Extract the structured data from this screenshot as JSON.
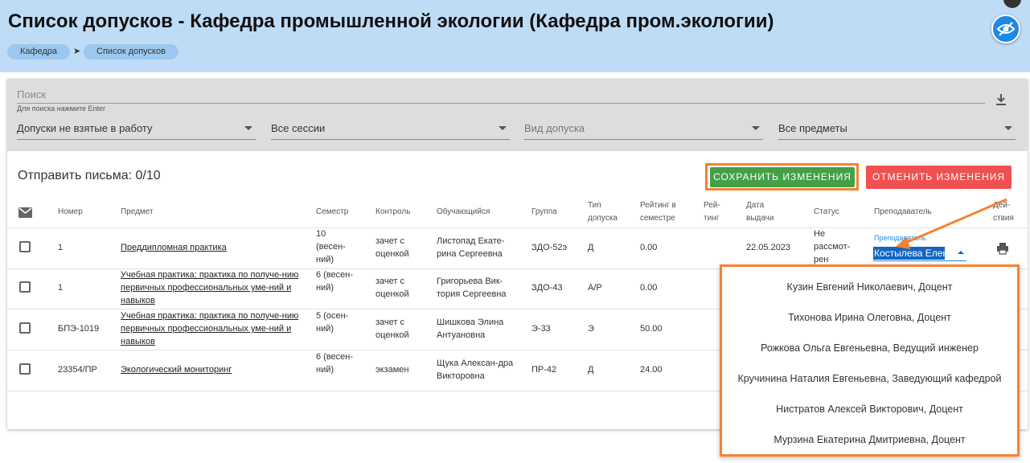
{
  "header": {
    "title": "Список допусков - Кафедра промышленной экологии (Кафедра пром.экологии)",
    "breadcrumbs": [
      "Кафедра",
      "Список допусков"
    ]
  },
  "filters": {
    "search_placeholder": "Поиск",
    "search_hint": "Для поиска нажмите Enter",
    "selects": [
      "Допуски не взятые в работу",
      "Все сессии",
      "Вид допуска",
      "Все предметы"
    ]
  },
  "toolbar": {
    "mail_count": "Отправить письма: 0/10",
    "save_label": "СОХРАНИТЬ ИЗМЕНЕНИЯ",
    "cancel_label": "ОТМЕНИТЬ ИЗМЕНЕНИЯ"
  },
  "table": {
    "headers": {
      "number": "Номер",
      "subject": "Предмет",
      "semester": "Семестр",
      "control": "Контроль",
      "student": "Обучающийся",
      "group": "Группа",
      "type": "Тип допуска",
      "rating_sem": "Рейтинг в семестре",
      "rating": "Рей-тинг",
      "date": "Дата выдачи",
      "status": "Статус",
      "teacher": "Преподаватель",
      "actions": "Дей-ствия"
    },
    "rows": [
      {
        "number": "1",
        "subject": "Преддипломная практика",
        "semester": "10 (весен-ний)",
        "control": "зачет с оценкой",
        "student": "Листопад Екате-рина Сергеевна",
        "group": "ЗДО-52э",
        "type": "Д",
        "rating_sem": "0.00",
        "date": "22.05.2023",
        "status": "Не рассмот-рен"
      },
      {
        "number": "1",
        "subject": "Учебная практика: практика по получе-нию первичных профессиональных уме-ний и навыков",
        "semester": "6 (весен-ний)",
        "control": "зачет с оценкой",
        "student": "Григорьева Вик-тория Сергеевна",
        "group": "ЗДО-43",
        "type": "А/Р",
        "rating_sem": "0.00"
      },
      {
        "number": "БПЭ-1019",
        "subject": "Учебная практика: практика по получе-нию первичных профессиональных уме-ний и навыков",
        "semester": "5 (осен-ний)",
        "control": "зачет с оценкой",
        "student": "Шишкова Элина Антуановна",
        "group": "Э-33",
        "type": "Э",
        "rating_sem": "50.00"
      },
      {
        "number": "23354/ПР",
        "subject": "Экологический мониторинг",
        "semester": "6 (весен-ний)",
        "control": "экзамен",
        "student": "Щука Алексан-дра Викторовна",
        "group": "ПР-42",
        "type": "Д",
        "rating_sem": "24.00"
      }
    ]
  },
  "teacher_select": {
    "label": "Преподаватель",
    "value": "Костылева Елен",
    "options": [
      "Кузин Евгений Николаевич, Доцент",
      "Тихонова Ирина Олеговна, Доцент",
      "Рожкова Ольга Евгеньевна, Ведущий инженер",
      "Кручинина Наталия Евгеньевна, Заведующий кафедрой",
      "Нистратов Алексей Викторович, Доцент",
      "Мурзина Екатерина Дмитриевна, Доцент"
    ]
  },
  "colors": {
    "header_bg": "#bfdcf6",
    "save": "#43a047",
    "cancel": "#f05050",
    "highlight": "#f58233",
    "accent": "#1e88e5"
  }
}
